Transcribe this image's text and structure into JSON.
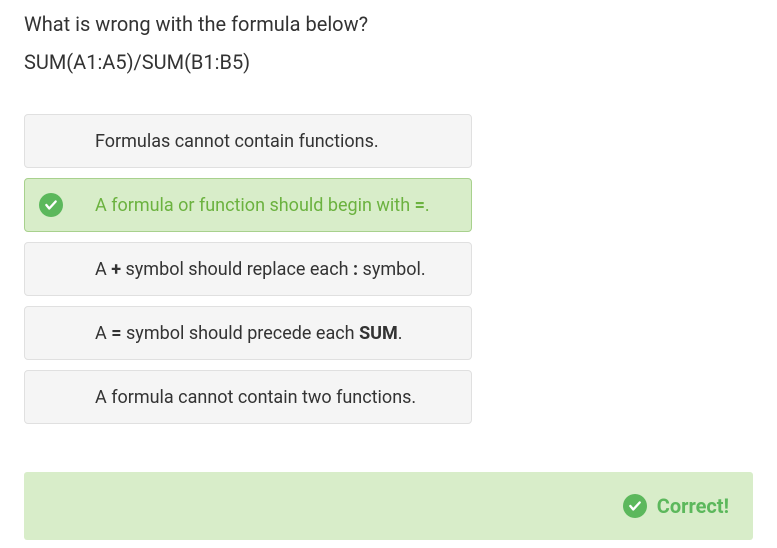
{
  "question": {
    "title": "What is wrong with the formula below?",
    "formula": "SUM(A1:A5)/SUM(B1:B5)"
  },
  "options": [
    {
      "segments": [
        {
          "text": "Formulas cannot contain functions.",
          "bold": false
        }
      ],
      "correct": false
    },
    {
      "segments": [
        {
          "text": "A formula or function should begin with ",
          "bold": false
        },
        {
          "text": "=",
          "bold": true
        },
        {
          "text": ".",
          "bold": false
        }
      ],
      "correct": true
    },
    {
      "segments": [
        {
          "text": "A ",
          "bold": false
        },
        {
          "text": "+",
          "bold": true
        },
        {
          "text": " symbol should replace each ",
          "bold": false
        },
        {
          "text": ":",
          "bold": true
        },
        {
          "text": " symbol.",
          "bold": false
        }
      ],
      "correct": false
    },
    {
      "segments": [
        {
          "text": "A ",
          "bold": false
        },
        {
          "text": "=",
          "bold": true
        },
        {
          "text": " symbol should precede each ",
          "bold": false
        },
        {
          "text": "SUM",
          "bold": true
        },
        {
          "text": ".",
          "bold": false
        }
      ],
      "correct": false
    },
    {
      "segments": [
        {
          "text": "A formula cannot contain two functions.",
          "bold": false
        }
      ],
      "correct": false
    }
  ],
  "feedback": {
    "label": "Correct!"
  }
}
